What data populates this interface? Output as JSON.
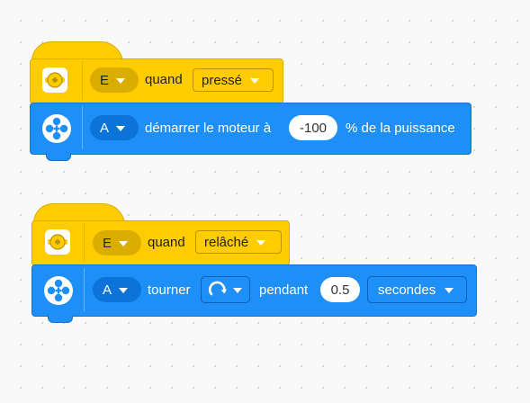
{
  "stack1": {
    "hat": {
      "port_value": "E",
      "when_label": "quand",
      "event_value": "pressé",
      "icon": "force-sensor-icon"
    },
    "action": {
      "port_value": "A",
      "label_start": "démarrer le moteur à",
      "power_value": "-100",
      "label_end": "% de la puissance",
      "icon": "motor-icon"
    }
  },
  "stack2": {
    "hat": {
      "port_value": "E",
      "when_label": "quand",
      "event_value": "relâché",
      "icon": "force-sensor-icon"
    },
    "action": {
      "port_value": "A",
      "label_turn": "tourner",
      "direction_icon": "clockwise-arrow-icon",
      "label_during": "pendant",
      "amount_value": "0.5",
      "unit_value": "secondes",
      "icon": "motor-icon"
    }
  },
  "colors": {
    "event_yellow": "#ffcc00",
    "motor_blue": "#1e8ff6",
    "canvas": "#f9f9f9"
  }
}
